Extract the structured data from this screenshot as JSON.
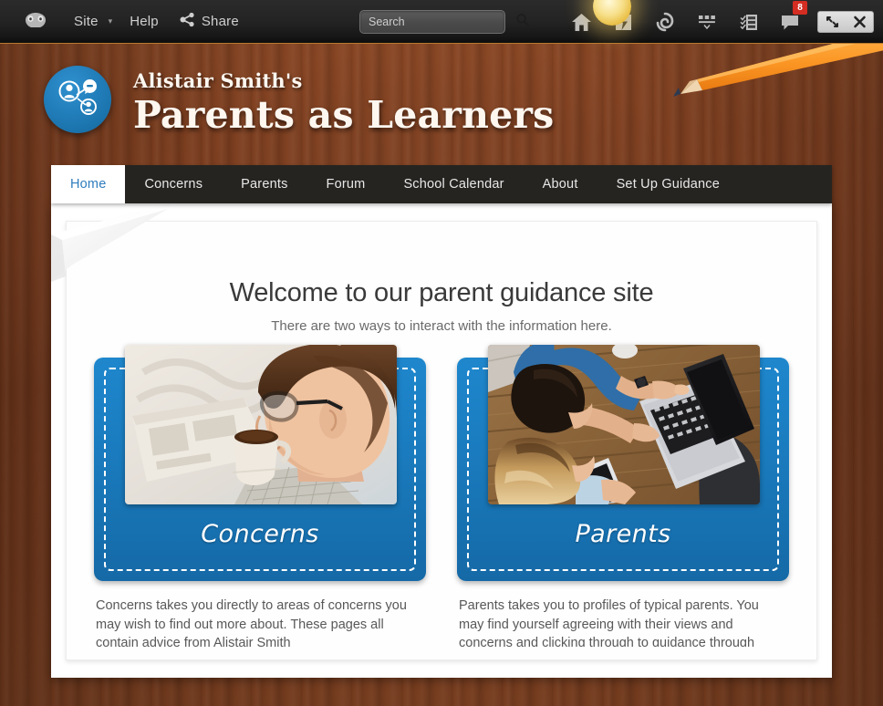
{
  "toolbar": {
    "logo_icon": "site-logo-icon",
    "site_label": "Site",
    "caret": "▾",
    "help_label": "Help",
    "share_label": "Share",
    "share_icon": "share-icon",
    "search": {
      "placeholder": "Search",
      "value": "",
      "icon": "search-icon"
    },
    "icons": [
      {
        "name": "home-icon",
        "title": "Home"
      },
      {
        "name": "lightning-icon",
        "title": "Activity"
      },
      {
        "name": "spiral-icon",
        "title": "Refresh"
      },
      {
        "name": "layout-icon",
        "title": "Layout"
      },
      {
        "name": "checklist-icon",
        "title": "Tasks"
      },
      {
        "name": "chat-icon",
        "title": "Messages"
      }
    ],
    "notification_badge": "8",
    "window_buttons": [
      {
        "name": "restore-icon",
        "title": "Restore"
      },
      {
        "name": "close-icon",
        "title": "Close"
      }
    ]
  },
  "header": {
    "logo_icon": "people-network-icon",
    "title_small": "Alistair Smith's",
    "title_large": "Parents as Learners",
    "decoration_icon": "pencil-icon"
  },
  "nav": {
    "items": [
      {
        "label": "Home",
        "active": true
      },
      {
        "label": "Concerns",
        "active": false
      },
      {
        "label": "Parents",
        "active": false
      },
      {
        "label": "Forum",
        "active": false
      },
      {
        "label": "School Calendar",
        "active": false
      },
      {
        "label": "About",
        "active": false
      },
      {
        "label": "Set Up Guidance",
        "active": false
      }
    ]
  },
  "main": {
    "heading": "Welcome to our parent guidance site",
    "subheading": "There are two ways to interact with the information here.",
    "cards": [
      {
        "label": "Concerns",
        "photo_name": "man-reading-newspaper-with-coffee-photo",
        "description": "Concerns takes you directly to areas of concerns you may wish to find out more about.  These pages all contain advice from Alistair Smith"
      },
      {
        "label": "Parents",
        "photo_name": "couple-using-laptop-overhead-photo",
        "description": "Parents takes you to profiles of typical parents.  You may find yourself agreeing with their views and concerns and clicking through to guidance through these pages."
      }
    ]
  },
  "colors": {
    "accent_blue": "#1a7cbf",
    "nav_dark": "#262421",
    "wood_brown": "#7e3f20",
    "badge_red": "#d42d21",
    "active_nav_text": "#2f7dbd"
  }
}
